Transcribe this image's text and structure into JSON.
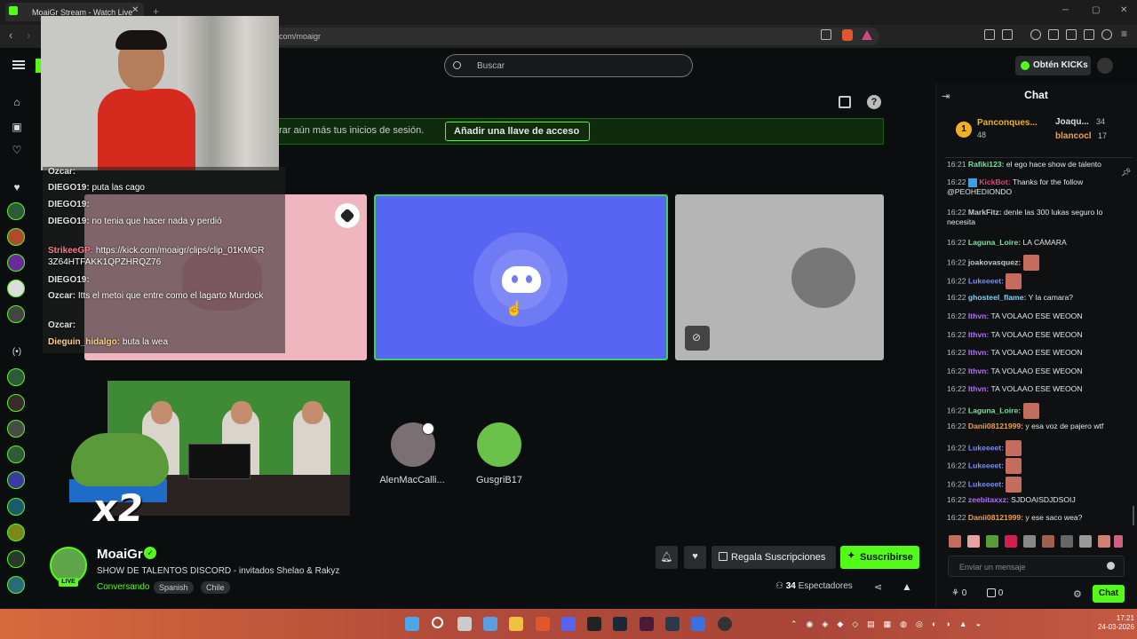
{
  "browser": {
    "tab_title": "MoaiGr Stream - Watch Live",
    "url": "com/moaigr"
  },
  "header": {
    "search_placeholder": "Buscar",
    "obten_label": "Obtén KICKs"
  },
  "banner": {
    "text": "rar aún más tus inicios de sesión.",
    "button_label": "Añadir una llave de acceso"
  },
  "stream_overlay_chat": [
    {
      "user": "Ozcar:",
      "text": ""
    },
    {
      "user": "DIEGO19:",
      "text": "puta las cago"
    },
    {
      "user": "DIEGO19:",
      "text": ""
    },
    {
      "user": "DIEGO19:",
      "text": "no tenia que hacer nada y perdió"
    },
    {
      "user": "StrikeeGP:",
      "text": "https://kick.com/moaigr/clips/clip_01KMGR 3Z64HTFAKK1QPZHRQZ76"
    },
    {
      "user": "DIEGO19:",
      "text": ""
    },
    {
      "user": "Ozcar:",
      "text": "Itts el metoi que entre como el lagarto Murdock"
    },
    {
      "user": "Ozcar:",
      "text": ""
    },
    {
      "user": "Dieguin_hidalgo:",
      "text": "buta la wea"
    }
  ],
  "audience": [
    {
      "name": "AlenMacCalli..."
    },
    {
      "name": "GusgriB17"
    }
  ],
  "overlay_text": "x2",
  "stream_info": {
    "streamer": "MoaiGr",
    "live_badge": "LIVE",
    "title": "SHOW DE TALENTOS DISCORD - invitados Shelao & Rakyz",
    "category": "Conversando",
    "tags": [
      "Spanish",
      "Chile"
    ],
    "gift_label": "Regala Suscripciones",
    "subscribe_label": "Suscribirse",
    "viewers": "34",
    "viewers_label": "Espectadores"
  },
  "chat": {
    "header": "Chat",
    "leaderboard": [
      {
        "name": "Panconques...",
        "value": "48"
      },
      {
        "name": "Joaqu...",
        "value": "34"
      },
      {
        "name": "blancocl",
        "value": "17"
      }
    ],
    "messages": [
      {
        "time": "16:21",
        "user": "Rafiki123:",
        "color": "#7ee0a0",
        "text": "el ego hace show de talento"
      },
      {
        "time": "16:22",
        "user": "KickBot:",
        "color": "#e0447a",
        "text": "Thanks for the follow @PEOHEDIONDO"
      },
      {
        "time": "16:22",
        "user": "MarkFitz:",
        "color": "#c9c9c9",
        "text": "denle las 300 lukas seguro lo necesita"
      },
      {
        "time": "16:22",
        "user": "Laguna_Loire:",
        "color": "#7ee0a0",
        "text": "LA CÁMARA"
      },
      {
        "time": "16:22",
        "user": "joakovasquez:",
        "color": "#c9c9c9",
        "text": ""
      },
      {
        "time": "16:22",
        "user": "Lukeeeet:",
        "color": "#7b8cff",
        "text": ""
      },
      {
        "time": "16:22",
        "user": "ghosteel_flame:",
        "color": "#7fd4ff",
        "text": "Y la camara?"
      },
      {
        "time": "16:22",
        "user": "Ithvn:",
        "color": "#b66cff",
        "text": "TA VOLAAO ESE WEOON"
      },
      {
        "time": "16:22",
        "user": "Ithvn:",
        "color": "#b66cff",
        "text": "TA VOLAAO ESE WEOON"
      },
      {
        "time": "16:22",
        "user": "Ithvn:",
        "color": "#b66cff",
        "text": "TA VOLAAO ESE WEOON"
      },
      {
        "time": "16:22",
        "user": "Ithvn:",
        "color": "#b66cff",
        "text": "TA VOLAAO ESE WEOON"
      },
      {
        "time": "16:22",
        "user": "Ithvn:",
        "color": "#b66cff",
        "text": "TA VOLAAO ESE WEOON"
      },
      {
        "time": "16:22",
        "user": "Laguna_Loire:",
        "color": "#7ee0a0",
        "text": ""
      },
      {
        "time": "16:22",
        "user": "Danii08121999:",
        "color": "#f0a050",
        "text": "y esa voz de pajero wtf"
      },
      {
        "time": "16:22",
        "user": "Lukeeeet:",
        "color": "#7b8cff",
        "text": ""
      },
      {
        "time": "16:22",
        "user": "Lukeeeet:",
        "color": "#7b8cff",
        "text": ""
      },
      {
        "time": "16:22",
        "user": "Lukeeeet:",
        "color": "#7b8cff",
        "text": ""
      },
      {
        "time": "16:22",
        "user": "zeebitaxxz:",
        "color": "#b66cff",
        "text": "SJDOAISDJDSOIJ"
      },
      {
        "time": "16:22",
        "user": "Danii08121999:",
        "color": "#f0a050",
        "text": "y ese saco wea?"
      }
    ],
    "input_placeholder": "Enviar un mensaje",
    "footer_left": "0",
    "footer_mid": "0",
    "send_label": "Chat"
  },
  "taskbar": {
    "time": "17:21",
    "date": "24-03-2026"
  },
  "colors": {
    "brand": "#53fc18",
    "discord": "#5865f2"
  }
}
